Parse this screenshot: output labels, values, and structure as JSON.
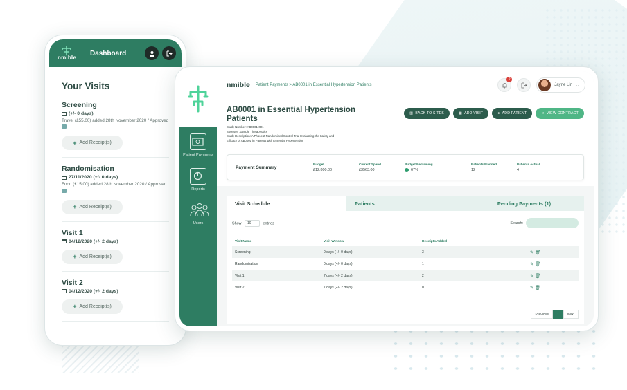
{
  "colors": {
    "brand_green": "#2e7d62",
    "dark_green": "#2c5c4c",
    "light_green": "#4fb686",
    "text_dark": "#2c4a42",
    "alert_red": "#d9403a"
  },
  "phone": {
    "logo": "nmible",
    "title": "Dashboard",
    "icons": [
      "user-icon",
      "logout-icon"
    ],
    "heading": "Your Visits",
    "add_receipt_label": "Add Receipt(s)",
    "visits": [
      {
        "name": "Screening",
        "date": "(+/- 0 days)",
        "note": "Travel (£55.00) added 28th November 2020 / Approved"
      },
      {
        "name": "Randomisation",
        "date": "27/11/2020 (+/- 0 days)",
        "note": "Food (£15.00) added 28th November 2020 / Approved"
      },
      {
        "name": "Visit 1",
        "date": "04/12/2020 (+/- 2 days)",
        "note": ""
      },
      {
        "name": "Visit 2",
        "date": "04/12/2020 (+/- 2 days)",
        "note": ""
      }
    ]
  },
  "tablet": {
    "brand": "nmible",
    "breadcrumb": "Patient Payments > AB0001 in Essential Hypertension Patients",
    "notification_count": "2",
    "user_name": "Jayne Lin",
    "sidebar": [
      {
        "label": "Patient Payments",
        "icon": "wallet-icon"
      },
      {
        "label": "Reports",
        "icon": "report-icon"
      },
      {
        "label": "Users",
        "icon": "users-icon"
      }
    ],
    "page_title": "AB0001 in Essential Hypertension Patients",
    "study_number": "Study Number: AB0001-001",
    "sponsor": "Sponsor: Xample Therapeutics",
    "study_description": "Study Description: A Phase 2 Randomised Control Trial Evaluating the Safety and Efficacy of AB0001 in Patients with Essential Hypertension",
    "buttons": {
      "back": "BACK TO SITES",
      "add_visit": "ADD VISIT",
      "add_patient": "ADD PATIENT",
      "view_contract": "VIEW CONTRACT"
    },
    "summary": {
      "label": "Payment Summary",
      "budget_h": "Budget",
      "budget_v": "£12,800.00",
      "spend_h": "Current Spend",
      "spend_v": "£3563.00",
      "remaining_h": "Budget Remaining",
      "remaining_v": "67%",
      "planned_h": "Patients Planned",
      "planned_v": "12",
      "actual_h": "Patients Actual",
      "actual_v": "4"
    },
    "tabs": [
      "Visit Schedule",
      "Patients",
      "Pending Payments (1)"
    ],
    "table": {
      "show": "Show",
      "entries_value": "10",
      "entries": "entries",
      "search_label": "Search:",
      "headers": [
        "Visit Name",
        "Visit Window",
        "Receipts Added",
        "",
        ""
      ],
      "rows": [
        {
          "name": "Screening",
          "window": "0 days (+/- 0 days)",
          "receipts": "3"
        },
        {
          "name": "Randomisation",
          "window": "0 days (+/- 0 days)",
          "receipts": "1"
        },
        {
          "name": "Visit 1",
          "window": "7 days (+/- 2 days)",
          "receipts": "2"
        },
        {
          "name": "Visit 2",
          "window": "7 days (+/- 2 days)",
          "receipts": "0"
        }
      ],
      "pager": {
        "prev": "Previous",
        "page": "1",
        "next": "Next"
      }
    }
  }
}
